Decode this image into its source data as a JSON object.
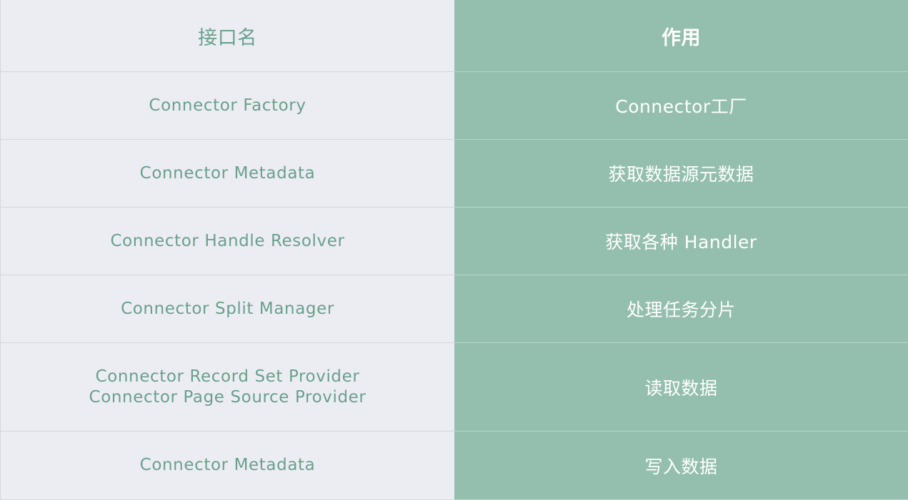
{
  "table": {
    "headers": {
      "interface_name": "接口名",
      "purpose": "作用"
    },
    "rows": [
      {
        "interface": [
          "Connector Factory"
        ],
        "purpose": "Connector工厂"
      },
      {
        "interface": [
          "Connector Metadata"
        ],
        "purpose": "获取数据源元数据"
      },
      {
        "interface": [
          "Connector Handle Resolver"
        ],
        "purpose": "获取各种 Handler"
      },
      {
        "interface": [
          "Connector Split Manager"
        ],
        "purpose": "处理任务分片"
      },
      {
        "interface": [
          "Connector Record Set Provider",
          "Connector Page Source Provider"
        ],
        "purpose": "读取数据"
      },
      {
        "interface": [
          "Connector Metadata"
        ],
        "purpose": "写入数据"
      }
    ]
  },
  "colors": {
    "left_bg": "#ecedf3",
    "left_text": "#6aa08b",
    "right_bg": "#94bfae",
    "right_text": "#ffffff"
  }
}
